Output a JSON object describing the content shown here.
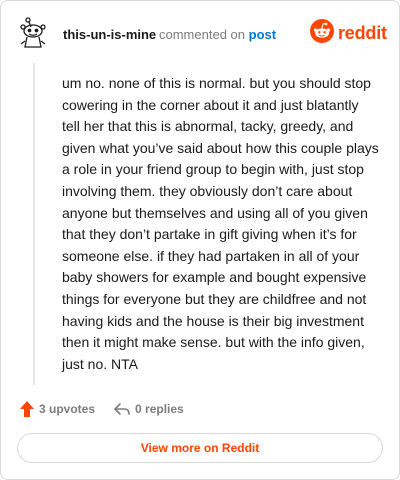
{
  "header": {
    "username": "this-un-is-mine",
    "action_text": "commented on",
    "post_link": "post",
    "brand": "reddit",
    "avatar_icon": "snoo-avatar-icon",
    "brand_icon": "reddit-logo-icon",
    "brand_color": "#ff4500"
  },
  "comment": {
    "body": "um no. none of this is normal. but you should stop cowering in the corner about it and just blatantly tell her that this is abnormal, tacky, greedy, and given what you’ve said about how this couple plays a role in your friend group to begin with, just stop involving them. they obviously don’t care about anyone but themselves and using all of you given that they don’t partake in gift giving when it’s for someone else. if they had partaken in all of your baby showers for example and bought expensive things for everyone but they are childfree and not having kids and the house is their big investment then it might make sense. but with the info given, just no. NTA"
  },
  "actions": {
    "upvotes": "3 upvotes",
    "replies": "0 replies",
    "upvote_icon": "upvote-arrow-icon",
    "reply_icon": "reply-arrow-icon",
    "upvote_color": "#ff4500"
  },
  "footer": {
    "view_more": "View more on Reddit"
  }
}
